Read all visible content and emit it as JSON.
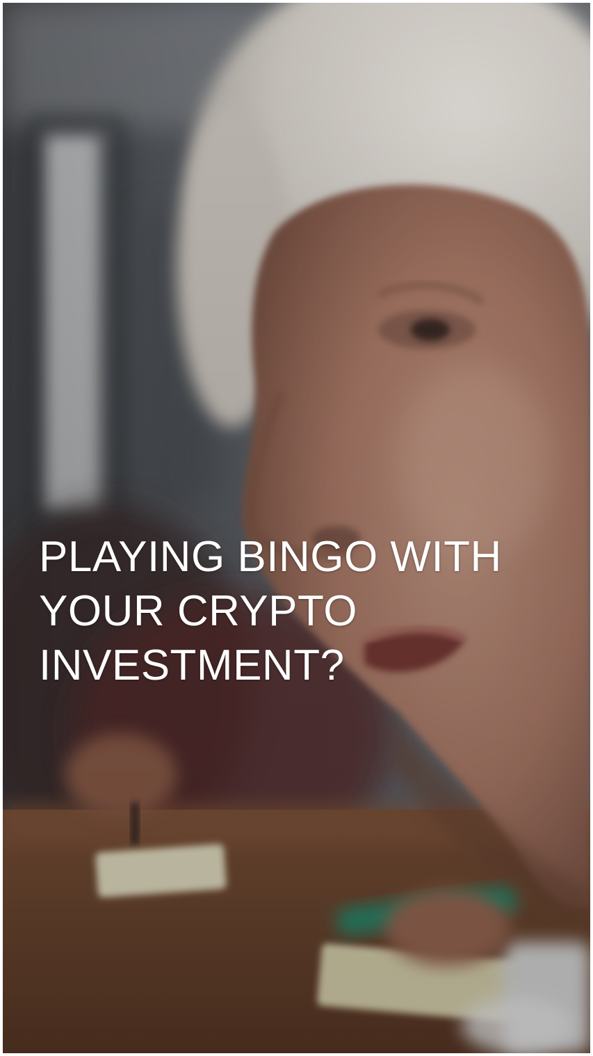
{
  "video": {
    "headline_lines": [
      "PLAYING BINGO WITH",
      "YOUR CRYPTO",
      "INVESTMENT?"
    ]
  }
}
